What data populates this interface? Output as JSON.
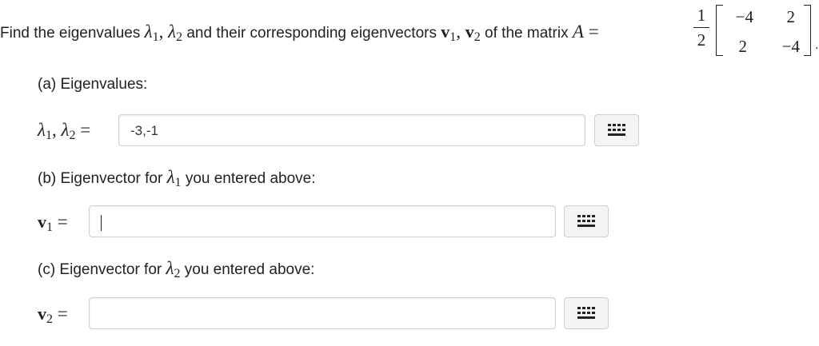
{
  "problem": {
    "lead": "Find the eigenvalues ",
    "mid": " and their corresponding eigenvectors ",
    "tail": " of the matrix ",
    "lambda_symbol": "λ",
    "v_symbol": "v",
    "sub1": "1",
    "sub2": "2",
    "comma": ", ",
    "matrix_name": "A",
    "equals": " = ",
    "scalar": {
      "numerator": "1",
      "denominator": "2"
    },
    "matrix": [
      [
        "−4",
        "2"
      ],
      [
        "2",
        "−4"
      ]
    ],
    "trailing": "."
  },
  "part_a": {
    "heading": "(a) Eigenvalues:",
    "label_lambda": "λ",
    "label_sub1": "1",
    "label_sub2": "2",
    "label_sep": ", ",
    "label_eq": " =",
    "input_value": "-3,-1",
    "keyboard_icon": "grid-keyboard-icon"
  },
  "part_b": {
    "heading_prefix": "(b) Eigenvector for ",
    "heading_lambda": "λ",
    "heading_sub": "1",
    "heading_suffix": " you entered above:",
    "label_v": "v",
    "label_sub": "1",
    "label_eq": " =",
    "input_value": "",
    "keyboard_icon": "grid-keyboard-icon"
  },
  "part_c": {
    "heading_prefix": "(c) Eigenvector for ",
    "heading_lambda": "λ",
    "heading_sub": "2",
    "heading_suffix": " you entered above:",
    "label_v": "v",
    "label_sub": "2",
    "label_eq": " =",
    "input_value": "",
    "keyboard_icon": "grid-keyboard-icon"
  }
}
